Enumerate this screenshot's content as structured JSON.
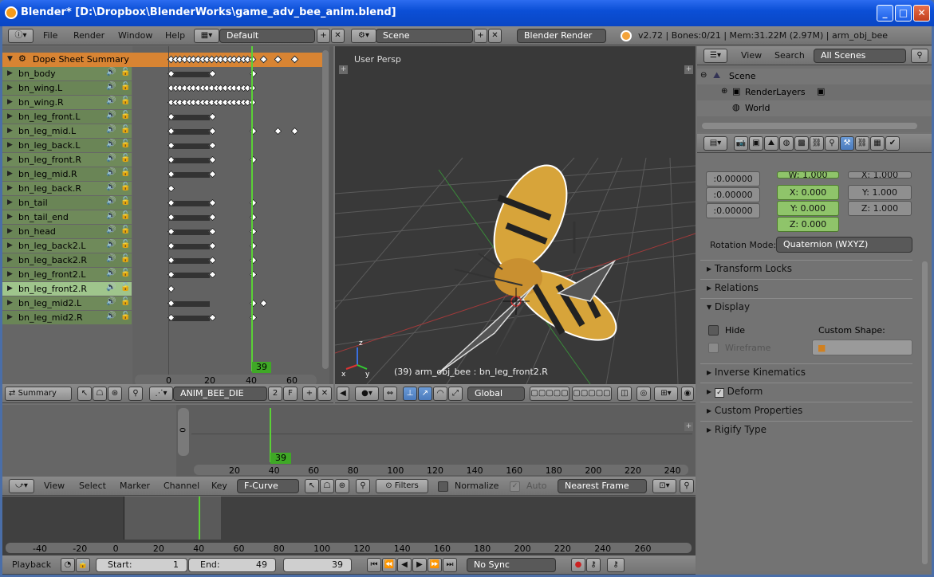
{
  "window": {
    "title": "Blender* [D:\\Dropbox\\BlenderWorks\\game_adv_bee_anim.blend]",
    "minimize": "_",
    "maximize": "□",
    "close": "✕"
  },
  "topbar": {
    "menus": [
      "File",
      "Render",
      "Window",
      "Help"
    ],
    "screen_layout": "Default",
    "scene": "Scene",
    "render_engine": "Blender Render",
    "stats": "v2.72 | Bones:0/21 | Mem:31.22M (2.97M) | arm_obj_bee"
  },
  "dopesheet": {
    "channels": [
      "Dope Sheet Summary",
      "bn_body",
      "bn_wing.L",
      "bn_wing.R",
      "bn_leg_front.L",
      "bn_leg_mid.L",
      "bn_leg_back.L",
      "bn_leg_front.R",
      "bn_leg_mid.R",
      "bn_leg_back.R",
      "bn_tail",
      "bn_tail_end",
      "bn_head",
      "bn_leg_back2.L",
      "bn_leg_back2.R",
      "bn_leg_front2.L",
      "bn_leg_front2.R",
      "bn_leg_mid2.L",
      "bn_leg_mid2.R"
    ],
    "selected_channel": "bn_leg_front2.R",
    "ruler": [
      "0",
      "20",
      "40",
      "60"
    ],
    "current_frame": "39",
    "header": {
      "mode": "Summary",
      "action": "ANIM_BEE_DIE",
      "users": "2",
      "fake": "F"
    }
  },
  "viewport": {
    "label": "User Persp",
    "status": "(39) arm_obj_bee : bn_leg_front2.R",
    "orientation": "Global"
  },
  "outliner": {
    "menus": [
      "View",
      "Search"
    ],
    "filter": "All Scenes",
    "items": [
      "Scene",
      "RenderLayers",
      "World"
    ]
  },
  "properties": {
    "rot_col1": [
      ":0.00000",
      ":0.00000",
      ":0.00000"
    ],
    "rot_col2": [
      "W: 1.000",
      "X: 0.000",
      "Y: 0.000",
      "Z: 0.000"
    ],
    "rot_col3": [
      "X: 1.000",
      "Y: 1.000",
      "Z: 1.000"
    ],
    "rotation_mode_label": "Rotation Mode:",
    "rotation_mode": "Quaternion (WXYZ)",
    "sections": [
      "Transform Locks",
      "Relations",
      "Display",
      "Inverse Kinematics",
      "Deform",
      "Custom Properties",
      "Rigify Type"
    ],
    "display": {
      "hide": "Hide",
      "custom_shape": "Custom Shape:",
      "wireframe": "Wireframe"
    }
  },
  "graph": {
    "ruler": [
      "20",
      "40",
      "60",
      "80",
      "100",
      "120",
      "140",
      "160",
      "180",
      "200",
      "220",
      "240"
    ],
    "current_frame": "39",
    "vlabel": "0",
    "header": {
      "menus": [
        "View",
        "Select",
        "Marker",
        "Channel",
        "Key"
      ],
      "mode": "F-Curve",
      "filters": "Filters",
      "normalize": "Normalize",
      "auto": "Auto",
      "snap": "Nearest Frame"
    }
  },
  "timeline": {
    "ruler": [
      "-40",
      "-20",
      "0",
      "20",
      "40",
      "60",
      "80",
      "100",
      "120",
      "140",
      "160",
      "180",
      "200",
      "220",
      "240",
      "260"
    ],
    "playback": "Playback",
    "start": "Start:",
    "start_val": "1",
    "end": "End:",
    "end_val": "49",
    "current": "39",
    "sync": "No Sync"
  }
}
